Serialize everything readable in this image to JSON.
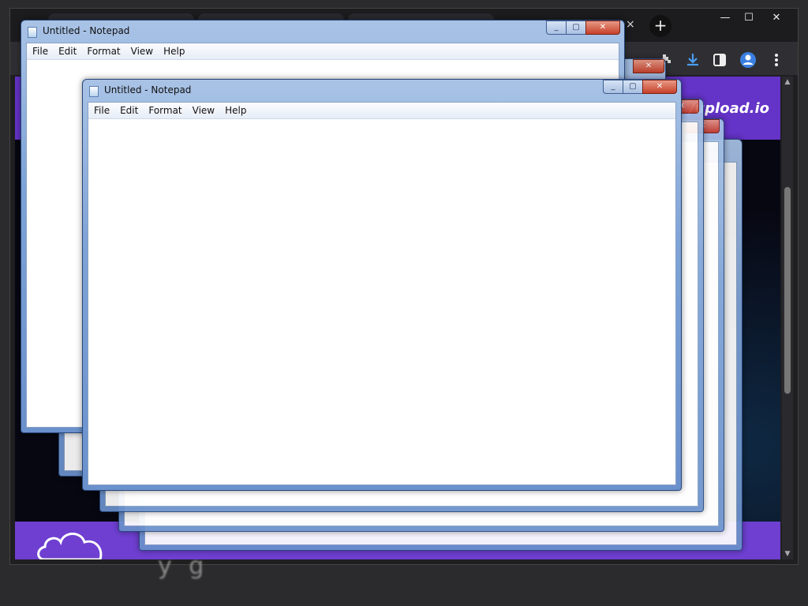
{
  "browser": {
    "tab_close": "×",
    "new_tab": "+",
    "window_controls": {
      "minimize": "—",
      "maximize": "☐",
      "close": "✕"
    },
    "toolbar_icons": [
      "extensions-icon",
      "download-icon",
      "side-panel-icon",
      "profile-icon",
      "menu-icon"
    ],
    "page": {
      "logo_text": "/upload.io",
      "header_color": "#6433c7",
      "footer_color": "#6e3fd0",
      "blurred_text": "y        g"
    }
  },
  "windows": [
    {
      "title": "Untitled - Notepad",
      "menu": [
        "File",
        "Edit",
        "Format",
        "View",
        "Help"
      ],
      "close": "✕",
      "restore": "▢",
      "minimize": "_"
    },
    {
      "title": "Untitled - Notepad",
      "menu": [
        "File",
        "Edit",
        "Format",
        "View",
        "Help"
      ],
      "close": "✕",
      "restore": "▢",
      "minimize": "_"
    }
  ],
  "stacked_window_close_label": "✕",
  "colors": {
    "titlebar": "#7ea3d6",
    "close_button": "#c6402a",
    "browser_bg": "#1f1f22"
  }
}
